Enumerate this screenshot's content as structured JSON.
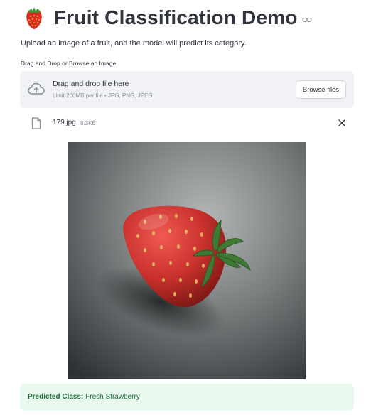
{
  "header": {
    "title": "Fruit Classification Demo",
    "icon": "strawberry-emoji",
    "link_icon": "link-icon"
  },
  "intro": {
    "text": "Upload an image of a fruit, and the model will predict its category."
  },
  "uploader": {
    "label": "Drag and Drop or Browse an Image",
    "drop_text": "Drag and drop file here",
    "limit_text": "Limit 200MB per file • JPG, PNG, JPEG",
    "browse_label": "Browse files",
    "icon": "cloud-upload-icon"
  },
  "file": {
    "name": "179.jpg",
    "size": "8.3KB",
    "icon": "file-icon",
    "remove_icon": "close-icon"
  },
  "preview": {
    "subject": "strawberry"
  },
  "result": {
    "label": "Predicted Class:",
    "value": "Fresh Strawberry"
  },
  "colors": {
    "text": "#31333f",
    "dropzone_bg": "#f0f2f6",
    "success_bg": "#eaf9ee",
    "success_text": "#1d6f3a"
  }
}
